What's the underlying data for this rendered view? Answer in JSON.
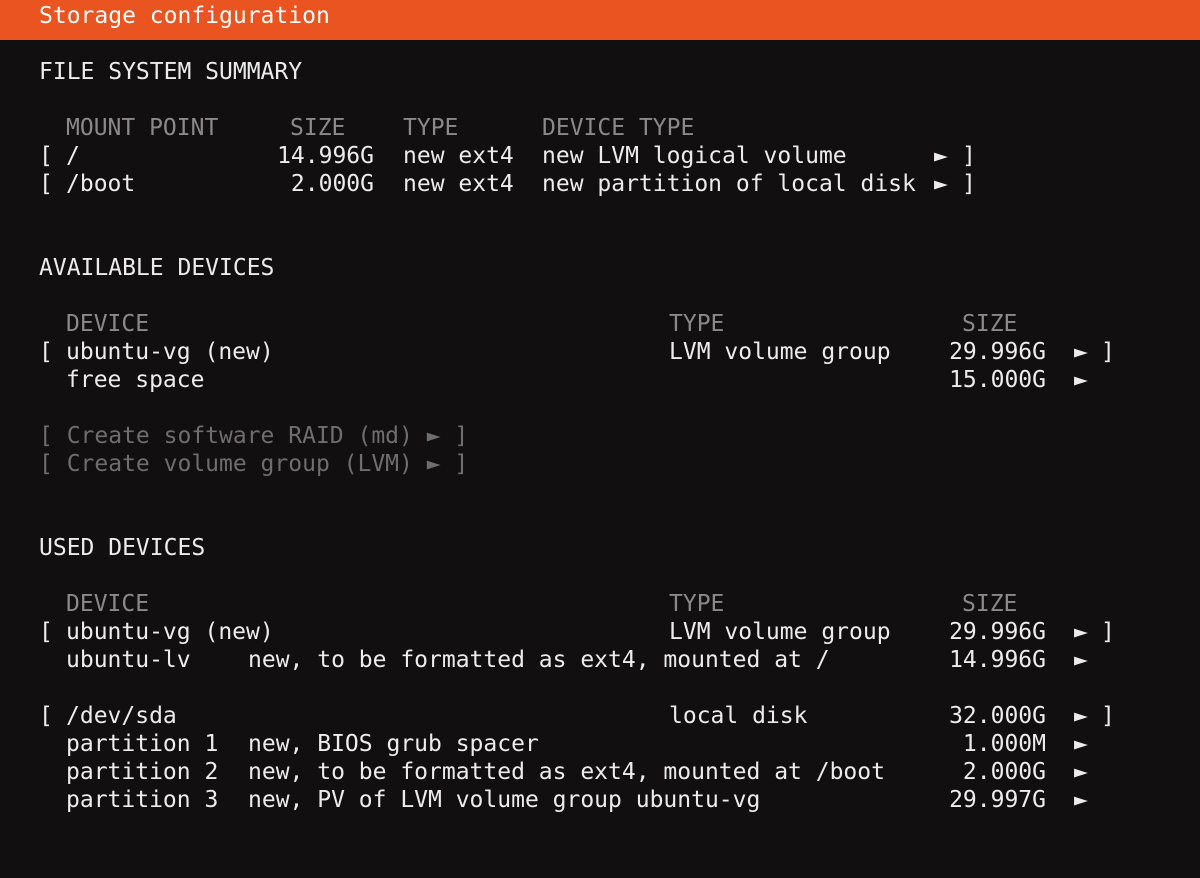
{
  "colors": {
    "accent": "#e95420",
    "background": "#110f10",
    "text": "#ececec",
    "dim": "#8a8a8a",
    "disabled": "#6e6e6e"
  },
  "title": "Storage configuration",
  "fs_summary": {
    "heading": "FILE SYSTEM SUMMARY",
    "headers": {
      "mount": "MOUNT POINT",
      "size": "SIZE",
      "type": "TYPE",
      "device_type": "DEVICE TYPE"
    },
    "rows": [
      {
        "open": "[",
        "mount": "/",
        "size": "14.996G",
        "type": "new ext4",
        "device_type": "new LVM logical volume",
        "arrow": "►",
        "close": "]"
      },
      {
        "open": "[",
        "mount": "/boot",
        "size": "2.000G",
        "type": "new ext4",
        "device_type": "new partition of local disk",
        "arrow": "►",
        "close": "]"
      }
    ]
  },
  "available": {
    "heading": "AVAILABLE DEVICES",
    "headers": {
      "device": "DEVICE",
      "type": "TYPE",
      "size": "SIZE"
    },
    "rows": [
      {
        "open": "[",
        "device": "ubuntu-vg (new)",
        "type": "LVM volume group",
        "size": "29.996G",
        "arrow": "►",
        "close": "]"
      },
      {
        "device": "free space",
        "size": "15.000G",
        "arrow": "►"
      }
    ],
    "actions": [
      {
        "label": "[ Create software RAID (md) ► ]"
      },
      {
        "label": "[ Create volume group (LVM) ► ]"
      }
    ]
  },
  "used": {
    "heading": "USED DEVICES",
    "headers": {
      "device": "DEVICE",
      "type": "TYPE",
      "size": "SIZE"
    },
    "rows": [
      {
        "open": "[",
        "device": "ubuntu-vg (new)",
        "type": "LVM volume group",
        "size": "29.996G",
        "arrow": "►",
        "close": "]"
      },
      {
        "device": "ubuntu-lv",
        "desc": "new, to be formatted as ext4, mounted at /",
        "size": "14.996G",
        "arrow": "►"
      },
      {
        "open": "[",
        "device": "/dev/sda",
        "type": "local disk",
        "size": "32.000G",
        "arrow": "►",
        "close": "]"
      },
      {
        "device": "partition 1",
        "desc": "new, BIOS grub spacer",
        "size": "1.000M",
        "arrow": "►"
      },
      {
        "device": "partition 2",
        "desc": "new, to be formatted as ext4, mounted at /boot",
        "size": "2.000G",
        "arrow": "►"
      },
      {
        "device": "partition 3",
        "desc": "new, PV of LVM volume group ubuntu-vg",
        "size": "29.997G",
        "arrow": "►"
      }
    ]
  }
}
